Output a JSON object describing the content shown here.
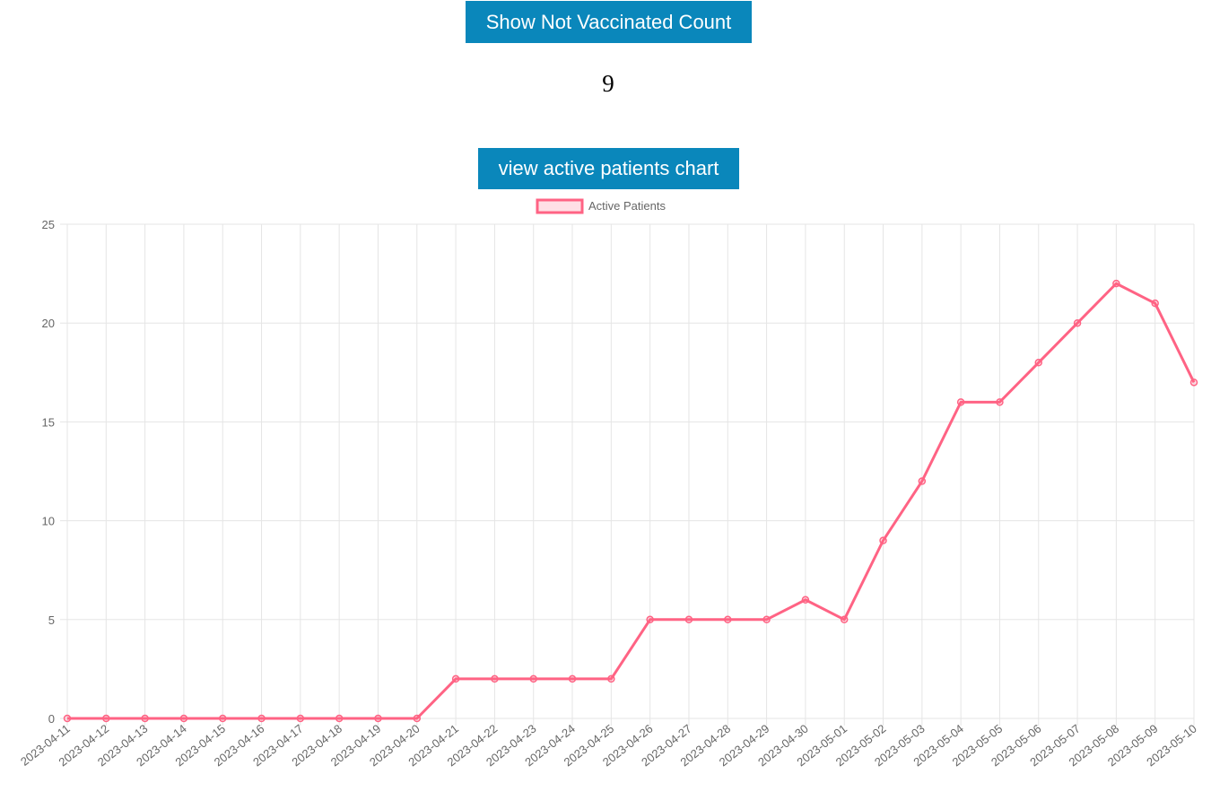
{
  "buttons": {
    "not_vaccinated": "Show Not Vaccinated Count",
    "active_chart": "view active patients chart"
  },
  "not_vaccinated_count": "9",
  "colors": {
    "button_bg": "#0a87bb",
    "series_line": "#ff6384",
    "series_fill": "rgba(255,99,132,0.2)",
    "grid": "#e5e5e5",
    "tick_text": "#666666"
  },
  "chart_data": {
    "type": "line",
    "x": [
      "2023-04-11",
      "2023-04-12",
      "2023-04-13",
      "2023-04-14",
      "2023-04-15",
      "2023-04-16",
      "2023-04-17",
      "2023-04-18",
      "2023-04-19",
      "2023-04-20",
      "2023-04-21",
      "2023-04-22",
      "2023-04-23",
      "2023-04-24",
      "2023-04-25",
      "2023-04-26",
      "2023-04-27",
      "2023-04-28",
      "2023-04-29",
      "2023-04-30",
      "2023-05-01",
      "2023-05-02",
      "2023-05-03",
      "2023-05-04",
      "2023-05-05",
      "2023-05-06",
      "2023-05-07",
      "2023-05-08",
      "2023-05-09",
      "2023-05-10"
    ],
    "series": [
      {
        "name": "Active Patients",
        "values": [
          0,
          0,
          0,
          0,
          0,
          0,
          0,
          0,
          0,
          0,
          2,
          2,
          2,
          2,
          2,
          5,
          5,
          5,
          5,
          6,
          5,
          9,
          12,
          16,
          16,
          18,
          20,
          22,
          21,
          17
        ]
      }
    ],
    "ylim": [
      0,
      25
    ],
    "yticks": [
      0,
      5,
      10,
      15,
      20,
      25
    ],
    "grid": true,
    "legend_position": "top-center"
  }
}
